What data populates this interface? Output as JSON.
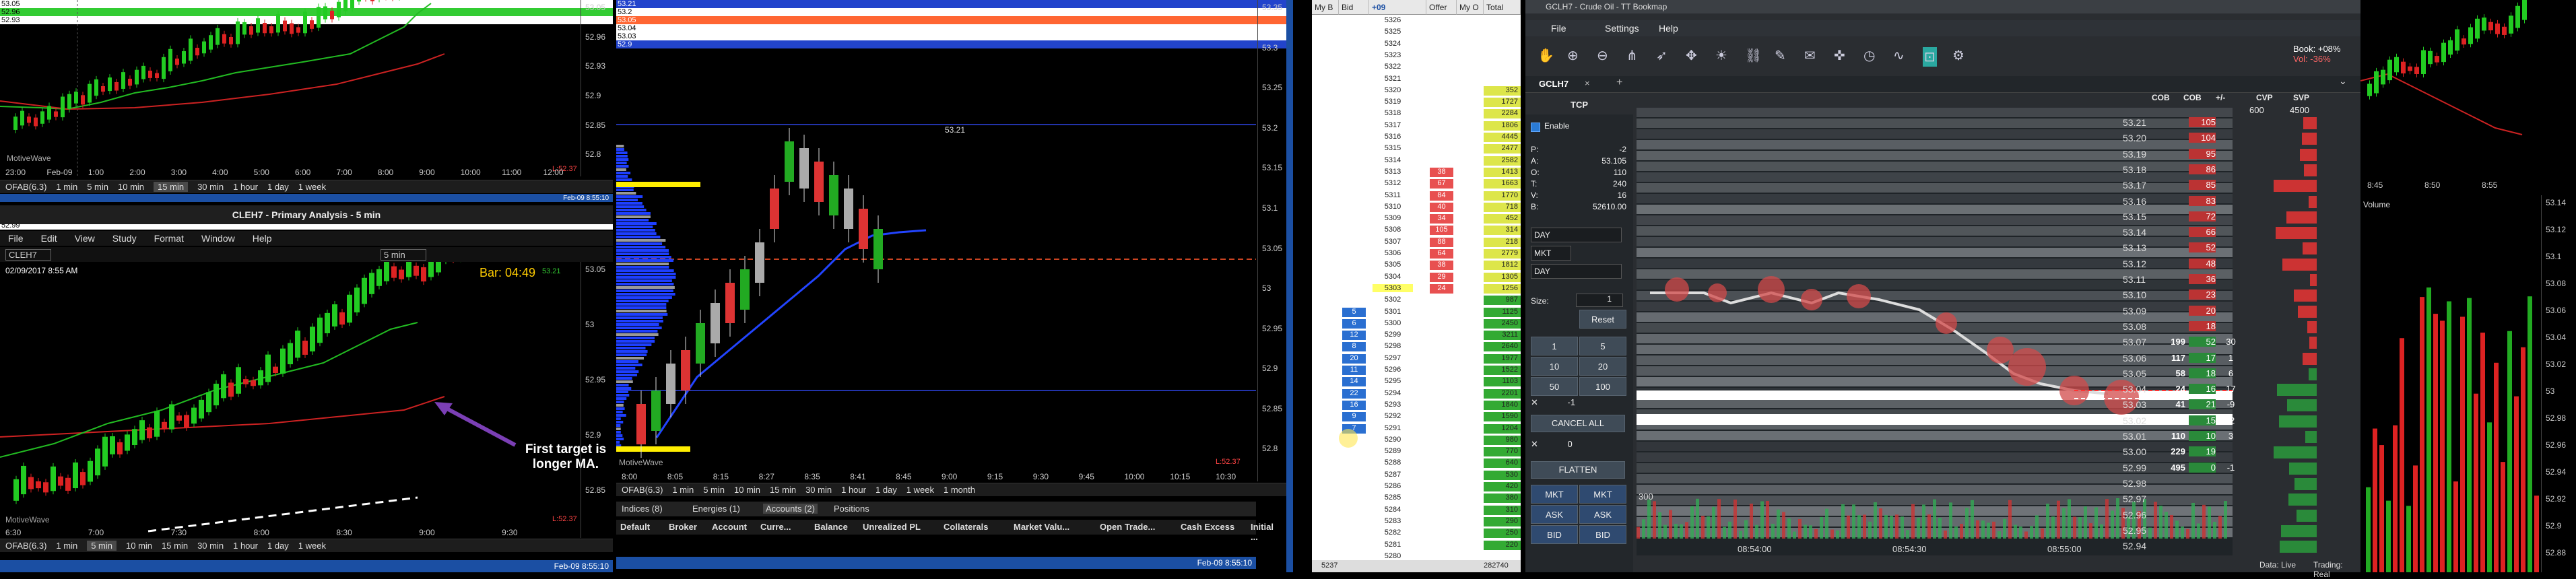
{
  "panel_top_left": {
    "price_axis": [
      "53.05",
      "52.96",
      "52.93",
      "52.9",
      "52.85",
      "52.8"
    ],
    "price_tags": [
      {
        "text": "53.05",
        "color": "#ffffff"
      },
      {
        "text": "52.96",
        "color": "#33cc33"
      },
      {
        "text": "52.93",
        "color": "#ffffff"
      }
    ],
    "time_axis": [
      "23:00",
      "Feb-09",
      "1:00",
      "2:00",
      "3:00",
      "4:00",
      "5:00",
      "6:00",
      "7:00",
      "8:00",
      "9:00",
      "10:00",
      "11:00",
      "12:00"
    ],
    "watermark": "MotiveWave",
    "bottom_right_tag": "L:52.37",
    "symbol": "OFAB(6.3)",
    "timeframes": [
      "1 min",
      "5 min",
      "10 min",
      "15 min",
      "30 min",
      "1 hour",
      "1 day",
      "1 week"
    ],
    "selected_timeframe": "15 min",
    "status_time": "Feb-09 8:55:10"
  },
  "panel_bottom_left": {
    "window_title": "CLEH7 - Primary Analysis - 5 min",
    "menu": [
      "File",
      "Edit",
      "View",
      "Study",
      "Format",
      "Window",
      "Help"
    ],
    "symbol_dropdown": "CLEH7",
    "interval_dropdown": "5 min",
    "date_time": "02/09/2017 8:55 AM",
    "bar_timer": "Bar: 04:49",
    "bar_price": "53.21",
    "annotation": "First target is longer MA.",
    "price_axis": [
      "53.05",
      "53",
      "52.95",
      "52.9",
      "52.85"
    ],
    "price_tags": [
      {
        "text": "53.05",
        "color": "#ffffff"
      },
      {
        "text": "53.03",
        "color": "#33cc33"
      },
      {
        "text": "52.99",
        "color": "#ffffff"
      }
    ],
    "time_axis": [
      "6:30",
      "7:00",
      "7:30",
      "8:00",
      "8:30",
      "9:00",
      "9:30"
    ],
    "watermark": "MotiveWave",
    "bottom_right_tag": "L:52.37",
    "symbol": "OFAB(6.3)",
    "timeframes": [
      "1 min",
      "5 min",
      "10 min",
      "15 min",
      "30 min",
      "1 hour",
      "1 day",
      "1 week"
    ],
    "selected_timeframe": "5 min",
    "status_time": "Feb-09 8:55:10"
  },
  "panel_center": {
    "price_axis": [
      "53.35",
      "53.3",
      "53.25",
      "53.2",
      "53.15",
      "53.1",
      "53.05",
      "53",
      "52.95",
      "52.9",
      "52.85",
      "52.8"
    ],
    "price_tags": [
      {
        "text": "53.21",
        "color": "#2244cc"
      },
      {
        "text": "53.2",
        "color": "#ffffff"
      },
      {
        "text": "53.05",
        "color": "#ff6633"
      },
      {
        "text": "53.04",
        "color": "#ffffff"
      },
      {
        "text": "53.03",
        "color": "#ffffff"
      },
      {
        "text": "52.9",
        "color": "#2244cc"
      }
    ],
    "line_label": "53.21",
    "time_axis": [
      "8:00",
      "8:05",
      "8:15",
      "8:27",
      "8:35",
      "8:41",
      "8:45",
      "9:00",
      "9:15",
      "9:30",
      "9:45",
      "10:00",
      "10:15",
      "10:30"
    ],
    "watermark": "MotiveWave",
    "bottom_right_tag": "L:52.37",
    "symbol": "OFAB(6.3)",
    "timeframes": [
      "1 min",
      "5 min",
      "10 min",
      "15 min",
      "30 min",
      "1 hour",
      "1 day",
      "1 week",
      "1 month"
    ],
    "account_tabs": [
      "Indices (8)",
      "Energies (1)",
      "Accounts (2)",
      "Positions"
    ],
    "selected_account_tab": "Accounts (2)",
    "account_columns": [
      "Default",
      "Broker",
      "Account",
      "Curre...",
      "Balance",
      "Unrealized PL",
      "Collaterals",
      "Market Valu...",
      "Open Trade...",
      "Cash Excess",
      "Initial ...",
      "Total I"
    ],
    "status_time": "Feb-09 8:55:10"
  },
  "ladder": {
    "columns": [
      "My B",
      "Bid",
      "+09",
      "Offer",
      "My O",
      "Total"
    ],
    "prices": [
      "5326",
      "5325",
      "5324",
      "5323",
      "5322",
      "5321",
      "5320",
      "5319",
      "5318",
      "5317",
      "5316",
      "5315",
      "5314",
      "5313",
      "5312",
      "5311",
      "5310",
      "5309",
      "5308",
      "5307",
      "5306",
      "5305",
      "5304",
      "5303",
      "5302",
      "5301",
      "5300",
      "5299",
      "5298",
      "5297",
      "5296",
      "5295",
      "5294",
      "5293",
      "5292",
      "5291",
      "5290",
      "5289",
      "5288",
      "5287",
      "5286",
      "5285",
      "5284",
      "5283",
      "5282",
      "5281",
      "5280"
    ],
    "offers": [
      "",
      "",
      "",
      "",
      "",
      "",
      "",
      "",
      "",
      "",
      "",
      "",
      "",
      "38",
      "67",
      "84",
      "40",
      "34",
      "105",
      "88",
      "64",
      "38",
      "29",
      "24",
      "",
      "",
      "",
      "",
      "",
      "",
      "",
      "",
      "",
      "",
      "",
      "",
      "",
      "",
      "",
      "",
      "",
      "",
      "",
      "",
      "",
      "",
      ""
    ],
    "bids": [
      "",
      "",
      "",
      "",
      "",
      "",
      "",
      "",
      "",
      "",
      "",
      "",
      "",
      "",
      "",
      "",
      "",
      "",
      "",
      "",
      "",
      "",
      "",
      "",
      "",
      "5",
      "6",
      "12",
      "8",
      "20",
      "11",
      "14",
      "22",
      "16",
      "9",
      "7",
      "",
      "",
      "",
      "",
      "",
      "",
      "",
      "",
      "",
      "",
      ""
    ],
    "totals": [
      "",
      "",
      "",
      "",
      "",
      "",
      "352",
      "1727",
      "2284",
      "1806",
      "4445",
      "2477",
      "2582",
      "1413",
      "1663",
      "1770",
      "718",
      "452",
      "314",
      "218",
      "2779",
      "1812",
      "1305",
      "1256",
      "987",
      "1125",
      "2450",
      "3211",
      "2640",
      "1977",
      "1522",
      "1103",
      "2201",
      "1840",
      "1590",
      "1204",
      "980",
      "770",
      "640",
      "530",
      "420",
      "380",
      "310",
      "290",
      "250",
      "220"
    ],
    "bottom_left": "5237",
    "bottom_right": "282740"
  },
  "tcp": {
    "window_title": "GCLH7 - Crude Oil - TT Bookmap",
    "menu": [
      "File",
      "Settings",
      "Help"
    ],
    "tab": "GCLH7",
    "side_header": "TCP",
    "enable_label": "Enable",
    "stats": [
      {
        "k": "P:",
        "v": "-2"
      },
      {
        "k": "A:",
        "v": "53.105"
      },
      {
        "k": "O:",
        "v": "110"
      },
      {
        "k": "T:",
        "v": "240"
      },
      {
        "k": "V:",
        "v": "16"
      },
      {
        "k": "B:",
        "v": "52610.00"
      }
    ],
    "tif_1": "DAY",
    "order_type": "MKT",
    "tif_2": "DAY",
    "size_label": "Size:",
    "size_value": "1",
    "reset_label": "Reset",
    "size_buttons": [
      "1",
      "5",
      "10",
      "20",
      "50",
      "100"
    ],
    "position_value": "-1",
    "cancel_all": "CANCEL ALL",
    "zero_value": "0",
    "flatten": "FLATTEN",
    "order_buttons": [
      "MKT",
      "MKT",
      "ASK",
      "ASK",
      "BID",
      "BID"
    ],
    "book_label": "Book: +08%",
    "vol_label": "Vol: -36%",
    "book_columns": [
      "COB",
      "COB",
      "+/-",
      "CVP",
      "SVP"
    ],
    "cvp_header_values": [
      "600",
      "4500"
    ],
    "book_prices": [
      "53.21",
      "53.20",
      "53.19",
      "53.18",
      "53.17",
      "53.16",
      "53.15",
      "53.14",
      "53.13",
      "53.12",
      "53.11",
      "53.10",
      "53.09",
      "53.08",
      "53.07",
      "53.06",
      "53.05",
      "53.04",
      "53.03",
      "53.02",
      "53.01",
      "53.00",
      "52.99",
      "52.98",
      "52.97",
      "52.96",
      "52.95",
      "52.94"
    ],
    "book_cob1": [
      "",
      "",
      "",
      "",
      "",
      "",
      "",
      "",
      "",
      "",
      "",
      "",
      "",
      "",
      "199",
      "117",
      "58",
      "24",
      "41",
      "115",
      "110",
      "229",
      "495",
      "",
      "",
      "",
      "",
      ""
    ],
    "book_cob2": [
      "105",
      "104",
      "95",
      "86",
      "85",
      "83",
      "72",
      "66",
      "52",
      "48",
      "36",
      "23",
      "20",
      "18",
      "52",
      "17",
      "18",
      "16",
      "21",
      "15",
      "10",
      "19",
      "0",
      "",
      "",
      "",
      "",
      ""
    ],
    "book_change": [
      "",
      "",
      "",
      "",
      "",
      "",
      "",
      "",
      "",
      "",
      "",
      "",
      "",
      "",
      "30",
      "1",
      "6",
      "17",
      "-9",
      "-2",
      "3",
      "",
      "-1",
      "",
      "",
      "",
      "",
      ""
    ],
    "left_axis": "300",
    "time_axis": [
      "08:54:00",
      "08:54:30",
      "08:55:00"
    ],
    "status_left": "Data: Live",
    "status_right": "Trading: Real"
  },
  "panel_right": {
    "time_axis": [
      "8:45",
      "8:50",
      "8:55"
    ],
    "volume_label": "Volume",
    "price_axis": [
      "53.14",
      "53.12",
      "53.1",
      "53.08",
      "53.06",
      "53.04",
      "53.02",
      "53",
      "52.98",
      "52.96",
      "52.94",
      "52.92",
      "52.9",
      "52.88"
    ]
  }
}
